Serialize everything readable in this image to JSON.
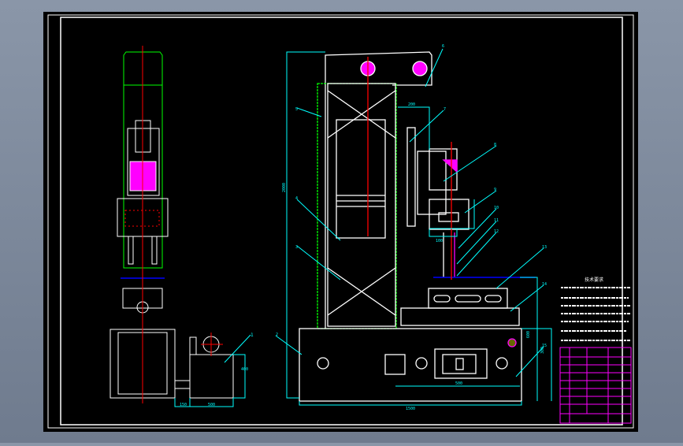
{
  "drawing": {
    "background": "#000000",
    "colors": {
      "outline": "#ffffff",
      "centerline": "#ff0000",
      "dimension": "#00ffff",
      "hidden": "#00ff00",
      "hatch": "#ff00ff",
      "reference": "#0000ff"
    },
    "balloons": [
      "1",
      "2",
      "3",
      "4",
      "5",
      "6",
      "7",
      "8",
      "9",
      "10",
      "11",
      "12",
      "13",
      "14",
      "15"
    ],
    "dimensions": {
      "side_width_a": "150",
      "side_width_b": "500",
      "tank_height": "400",
      "head_width": "200",
      "head_offset": "100",
      "window_width": "500",
      "overall_width": "1500",
      "overall_height": "2000",
      "right_height_a": "300",
      "right_height_b": "600"
    },
    "notes": {
      "heading": "技术要求"
    }
  }
}
